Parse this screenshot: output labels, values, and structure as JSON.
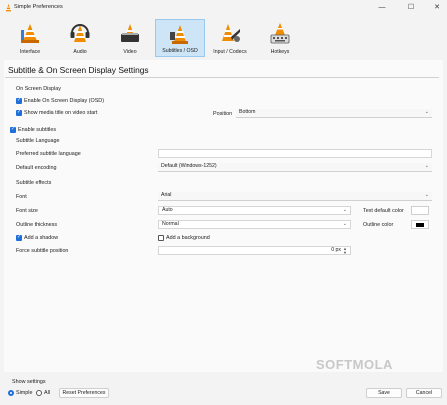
{
  "window": {
    "title": "Simple Preferences",
    "controls": {
      "minimize": "—",
      "maximize": "☐",
      "close": "✕"
    }
  },
  "toolbar": {
    "items": [
      {
        "label": "Interface",
        "icon": "interface-icon"
      },
      {
        "label": "Audio",
        "icon": "audio-icon"
      },
      {
        "label": "Video",
        "icon": "video-icon"
      },
      {
        "label": "Subtitles / OSD",
        "icon": "subtitles-icon",
        "active": true
      },
      {
        "label": "Input / Codecs",
        "icon": "input-codecs-icon"
      },
      {
        "label": "Hotkeys",
        "icon": "hotkeys-icon"
      }
    ]
  },
  "page_title": "Subtitle & On Screen Display Settings",
  "osd": {
    "group_title": "On Screen Display",
    "enable_osd": {
      "label": "Enable On Screen Display (OSD)",
      "checked": true
    },
    "show_title": {
      "label": "Show media title on video start",
      "checked": true
    },
    "position_label": "Position",
    "position_value": "Bottom"
  },
  "subtitles": {
    "enable": {
      "label": "Enable subtitles",
      "checked": true
    },
    "language_group": "Subtitle Language",
    "preferred_language_label": "Preferred subtitle language",
    "preferred_language_value": "",
    "encoding_label": "Default encoding",
    "encoding_value": "Default (Windows-1252)",
    "effects_group": "Subtitle effects",
    "font_label": "Font",
    "font_value": "Arial",
    "font_size_label": "Font size",
    "font_size_value": "Auto",
    "text_color_label": "Text default color",
    "outline_label": "Outline thickness",
    "outline_value": "Normal",
    "outline_color_label": "Outline color",
    "add_shadow": {
      "label": "Add a shadow",
      "checked": true
    },
    "add_background": {
      "label": "Add a background",
      "checked": false
    },
    "force_position_label": "Force subtitle position",
    "force_position_value": "0 px"
  },
  "footer": {
    "show_settings_label": "Show settings",
    "simple_label": "Simple",
    "all_label": "All",
    "reset_label": "Reset Preferences",
    "save_label": "Save",
    "cancel_label": "Cancel"
  },
  "watermark": "SOFTMOLA",
  "colors": {
    "accent": "#1e6fd9",
    "active_tab": "#cde5f7",
    "cone_orange": "#f08c00"
  }
}
